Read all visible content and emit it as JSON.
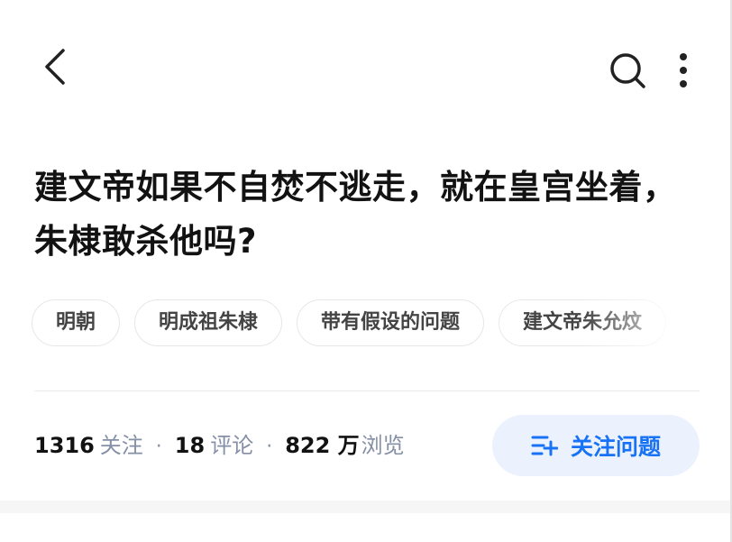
{
  "header": {
    "back_icon": "chevron-left-icon",
    "search_icon": "search-icon",
    "more_icon": "more-vertical-icon"
  },
  "question": {
    "title": "建文帝如果不自焚不逃走，就在皇宫坐着，朱棣敢杀他吗?"
  },
  "topics": [
    {
      "label": "明朝"
    },
    {
      "label": "明成祖朱棣"
    },
    {
      "label": "带有假设的问题"
    },
    {
      "label": "建文帝朱允炆"
    }
  ],
  "stats": {
    "followers_count": "1316",
    "followers_label": "关注",
    "comments_count": "18",
    "comments_label": "评论",
    "views_count": "822 万",
    "views_label": "浏览",
    "separator": "·"
  },
  "follow_button": {
    "label": "关注问题",
    "icon": "follow-list-plus-icon"
  },
  "colors": {
    "accent": "#1772f6",
    "follow_bg": "#ebf2fe",
    "muted_text": "#8590a6",
    "title_text": "#121212"
  }
}
